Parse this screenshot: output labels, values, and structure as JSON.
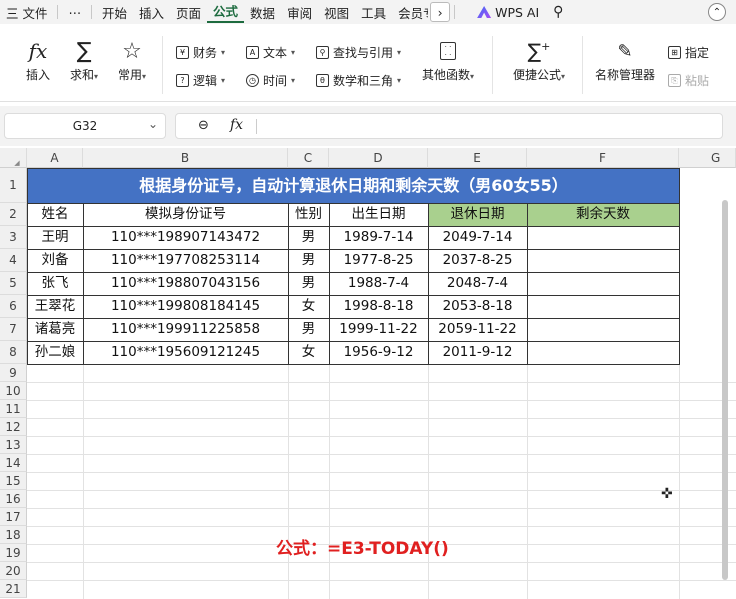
{
  "menubar": {
    "items": [
      "三 文件",
      "⋯",
      "开始",
      "插入",
      "页面",
      "公式",
      "数据",
      "审阅",
      "视图",
      "工具",
      "会员专"
    ],
    "active": "公式",
    "wps_ai": "WPS AI"
  },
  "ribbon": {
    "insert": "插入",
    "sum": "求和",
    "common": "常用",
    "finance": "财务",
    "text": "文本",
    "lookup": "查找与引用",
    "logic": "逻辑",
    "time": "时间",
    "math": "数学和三角",
    "other": "其他函数",
    "quick": "便捷公式",
    "name_mgr": "名称管理器",
    "specify": "指定",
    "paste": "粘贴"
  },
  "formula_bar": {
    "cell_ref": "G32",
    "content": ""
  },
  "columns": [
    "A",
    "B",
    "C",
    "D",
    "E",
    "F",
    "G"
  ],
  "rows": [
    "1",
    "2",
    "3",
    "4",
    "5",
    "6",
    "7",
    "8",
    "9",
    "10",
    "11",
    "12",
    "13",
    "14",
    "15",
    "16",
    "17",
    "18",
    "19",
    "20",
    "21"
  ],
  "table": {
    "title": "根据身份证号，自动计算退休日期和剩余天数（男60女55）",
    "headers": [
      "姓名",
      "模拟身份证号",
      "性别",
      "出生日期",
      "退休日期",
      "剩余天数"
    ],
    "rows": [
      [
        "王明",
        "110***198907143472",
        "男",
        "1989-7-14",
        "2049-7-14",
        ""
      ],
      [
        "刘备",
        "110***197708253114",
        "男",
        "1977-8-25",
        "2037-8-25",
        ""
      ],
      [
        "张飞",
        "110***198807043156",
        "男",
        "1988-7-4",
        "2048-7-4",
        ""
      ],
      [
        "王翠花",
        "110***199808184145",
        "女",
        "1998-8-18",
        "2053-8-18",
        ""
      ],
      [
        "诸葛亮",
        "110***199911225858",
        "男",
        "1999-11-22",
        "2059-11-22",
        ""
      ],
      [
        "孙二娘",
        "110***195609121245",
        "女",
        "1956-9-12",
        "2011-9-12",
        ""
      ]
    ]
  },
  "formula_note": "公式：=E3-TODAY()",
  "colors": {
    "title_bg": "#4472c4",
    "header_green": "#a9d08e",
    "note_red": "#e02020",
    "active_tab": "#1d6b3f"
  }
}
